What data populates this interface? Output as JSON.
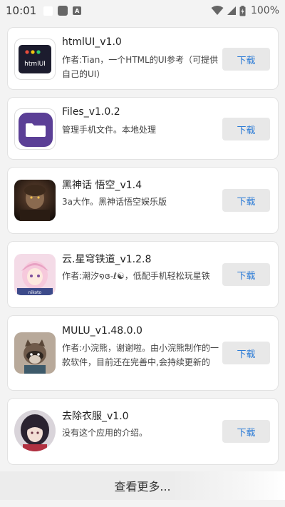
{
  "status_bar": {
    "time": "10:01",
    "battery": "100%"
  },
  "apps": [
    {
      "name": "htmlUI_v1.0",
      "description": "作者:Tian，一个HTML的UI参考（可提供自己的UI）",
      "button": "下载",
      "icon": "htmlui-logo-icon",
      "icon_text": "htmlUI"
    },
    {
      "name": "Files_v1.0.2",
      "description": "管理手机文件。本地处理",
      "button": "下载",
      "icon": "folder-icon"
    },
    {
      "name": "黑神话 悟空_v1.4",
      "description": "3a大作。黑神话悟空娱乐版",
      "button": "下载",
      "icon": "wukong-portrait-icon"
    },
    {
      "name": "云.星穹铁道_v1.2.8",
      "description": "作者:潮汐໑ɞ֊ℓ☯，低配手机轻松玩星铁",
      "button": "下载",
      "icon": "anime-girl-icon",
      "icon_text": "nikoto"
    },
    {
      "name": "MULU_v1.48.0.0",
      "description": "作者:小浣熊，谢谢啦。由小浣熊制作的一款软件，目前还在完善中,会持续更新的",
      "button": "下载",
      "icon": "raccoon-icon"
    },
    {
      "name": "去除衣服_v1.0",
      "description": "没有这个应用的介绍。",
      "button": "下载",
      "icon": "girl-portrait-icon"
    }
  ],
  "footer": {
    "more_label": "查看更多..."
  },
  "colors": {
    "button_bg": "#e8e8e8",
    "button_text": "#2b7bd6",
    "files_icon": "#5b3f96"
  }
}
